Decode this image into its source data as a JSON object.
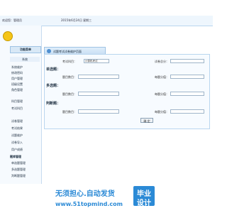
{
  "header": {
    "welcome": "欢迎您：管理员",
    "date": "2015年6月24日 星期三"
  },
  "sidebar": {
    "header": "功能菜单",
    "section": "系统",
    "items": [
      "系统维护",
      "修改密码",
      "用户管理",
      "班级设置",
      "角色管理",
      "科目管理",
      "考试科目",
      "试卷管理",
      "考试结果",
      "试题维护",
      "试卷导入",
      "用户成绩"
    ],
    "group2": "题库管理",
    "group2_items": [
      "单选题管理",
      "多选题管理",
      "判断题管理"
    ]
  },
  "main": {
    "tab_label": "试题考试试卷维护页面",
    "exam_subject_label": "考试科目：",
    "exam_subject_value": "计算机考试",
    "total_score_label": "试卷总分：",
    "single_section": "单选题：",
    "multi_section": "多选题：",
    "judge_section": "判断题：",
    "count_label": "题目数目：",
    "score_label": "每题分值：",
    "confirm_button": "确 定"
  },
  "watermark": {
    "line1": "无须担心.自动发货",
    "line2": "www.51topmind.com",
    "box_top": "毕业",
    "box_bottom": "设计"
  }
}
